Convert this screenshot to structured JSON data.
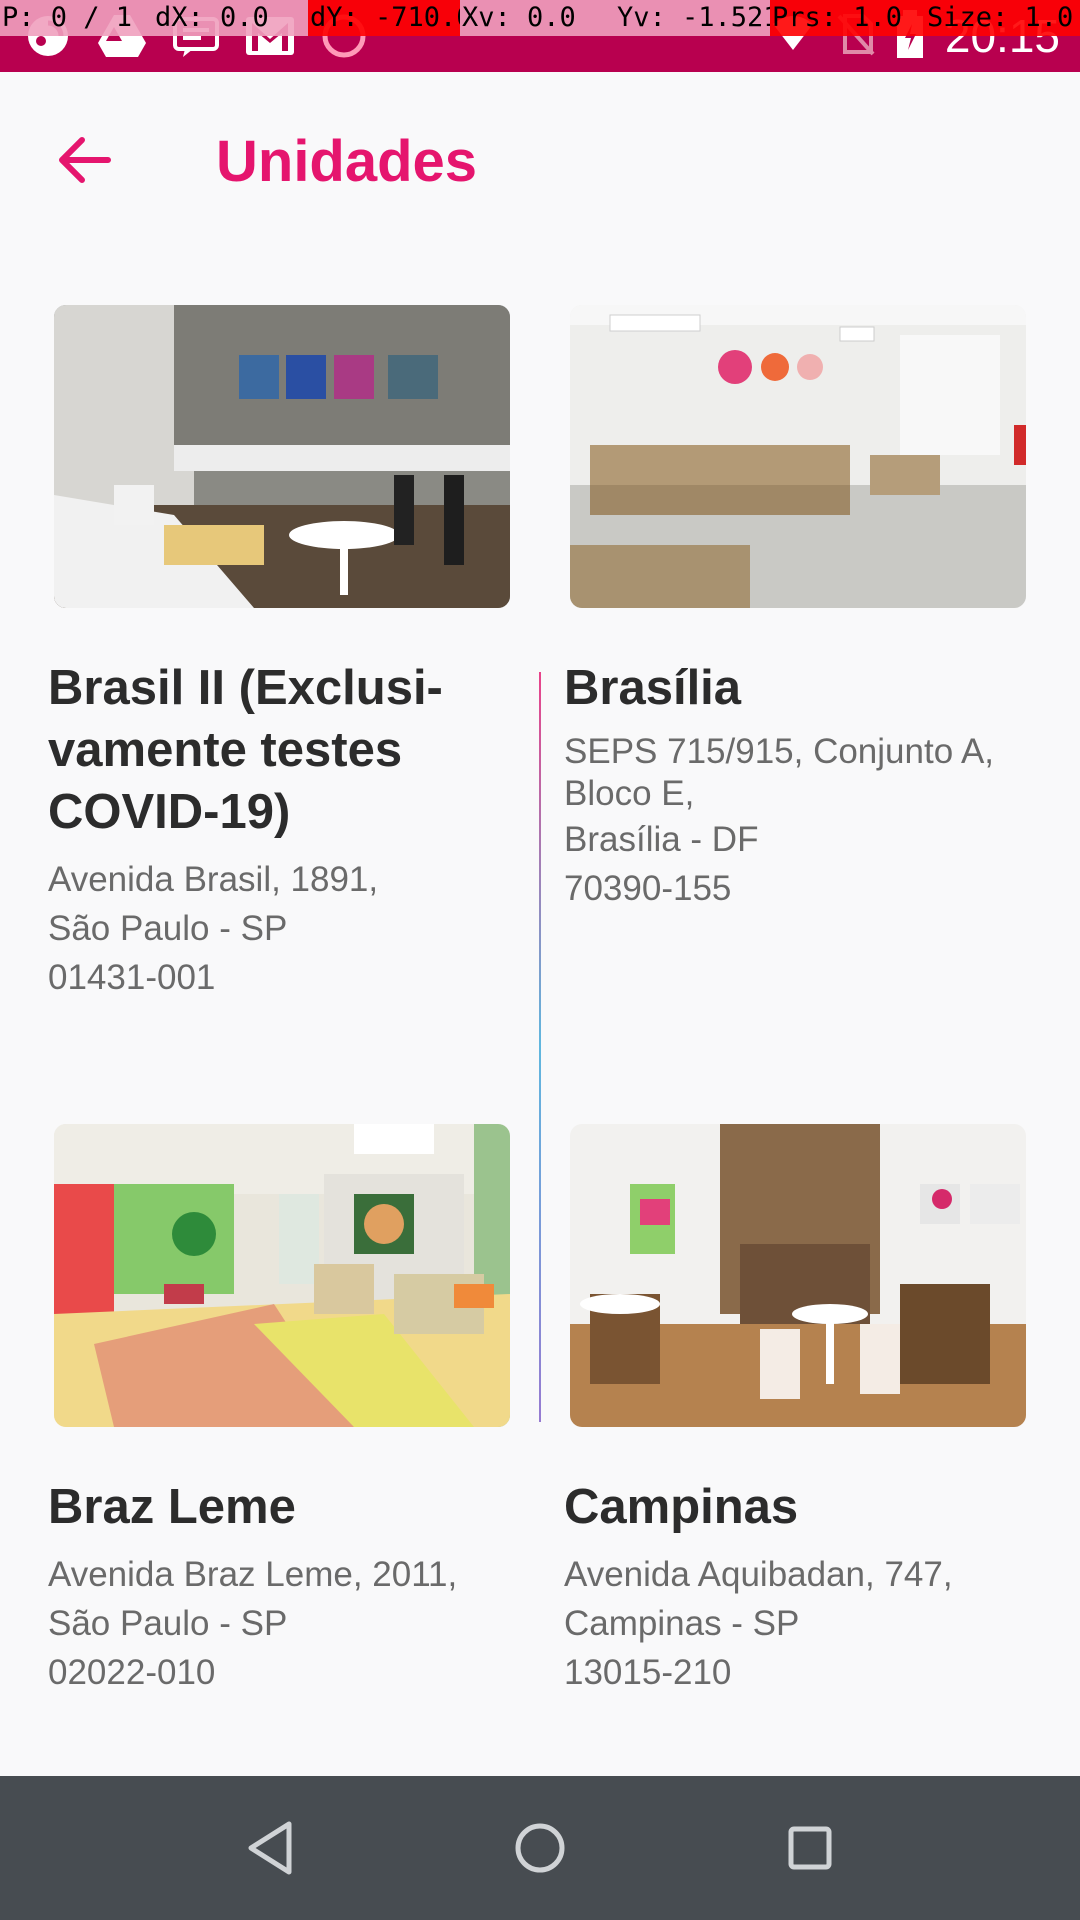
{
  "overlay": {
    "p": "P: 0 / 1",
    "dx": "dX: 0.0",
    "dy": "dY: -710.0",
    "xv": "Xv: 0.0",
    "yv": "Yv: -1.521",
    "prs": "Prs: 1.0",
    "size": "Size: 1.0"
  },
  "status_bar": {
    "time": "20:15",
    "color": "#b8004f",
    "icons": [
      "sync-icon",
      "drive-icon",
      "message-icon",
      "gmail-icon",
      "data-icon",
      "wifi-icon",
      "no-sim-icon",
      "battery-icon"
    ]
  },
  "header": {
    "title": "Unidades",
    "back_icon": "arrow-left-icon",
    "accent": "#e5156e"
  },
  "units": [
    {
      "name": "Brasil II (Exclusi-vamente testes COVID-19)",
      "address": [
        "Avenida Brasil, 1891,",
        "São Paulo - SP",
        "01431-001"
      ]
    },
    {
      "name": "Brasília",
      "address": [
        "SEPS 715/915, Conjunto A, Bloco E,",
        "Brasília - DF",
        "70390-155"
      ]
    },
    {
      "name": "Braz Leme",
      "address": [
        "Avenida Braz Leme, 2011,",
        "São Paulo - SP",
        "02022-010"
      ]
    },
    {
      "name": "Campinas",
      "address": [
        "Avenida Aquibadan, 747,",
        "Campinas - SP",
        "13015-210"
      ]
    }
  ],
  "nav": {
    "back": "nav-back-icon",
    "home": "nav-home-icon",
    "recents": "nav-recents-icon"
  }
}
